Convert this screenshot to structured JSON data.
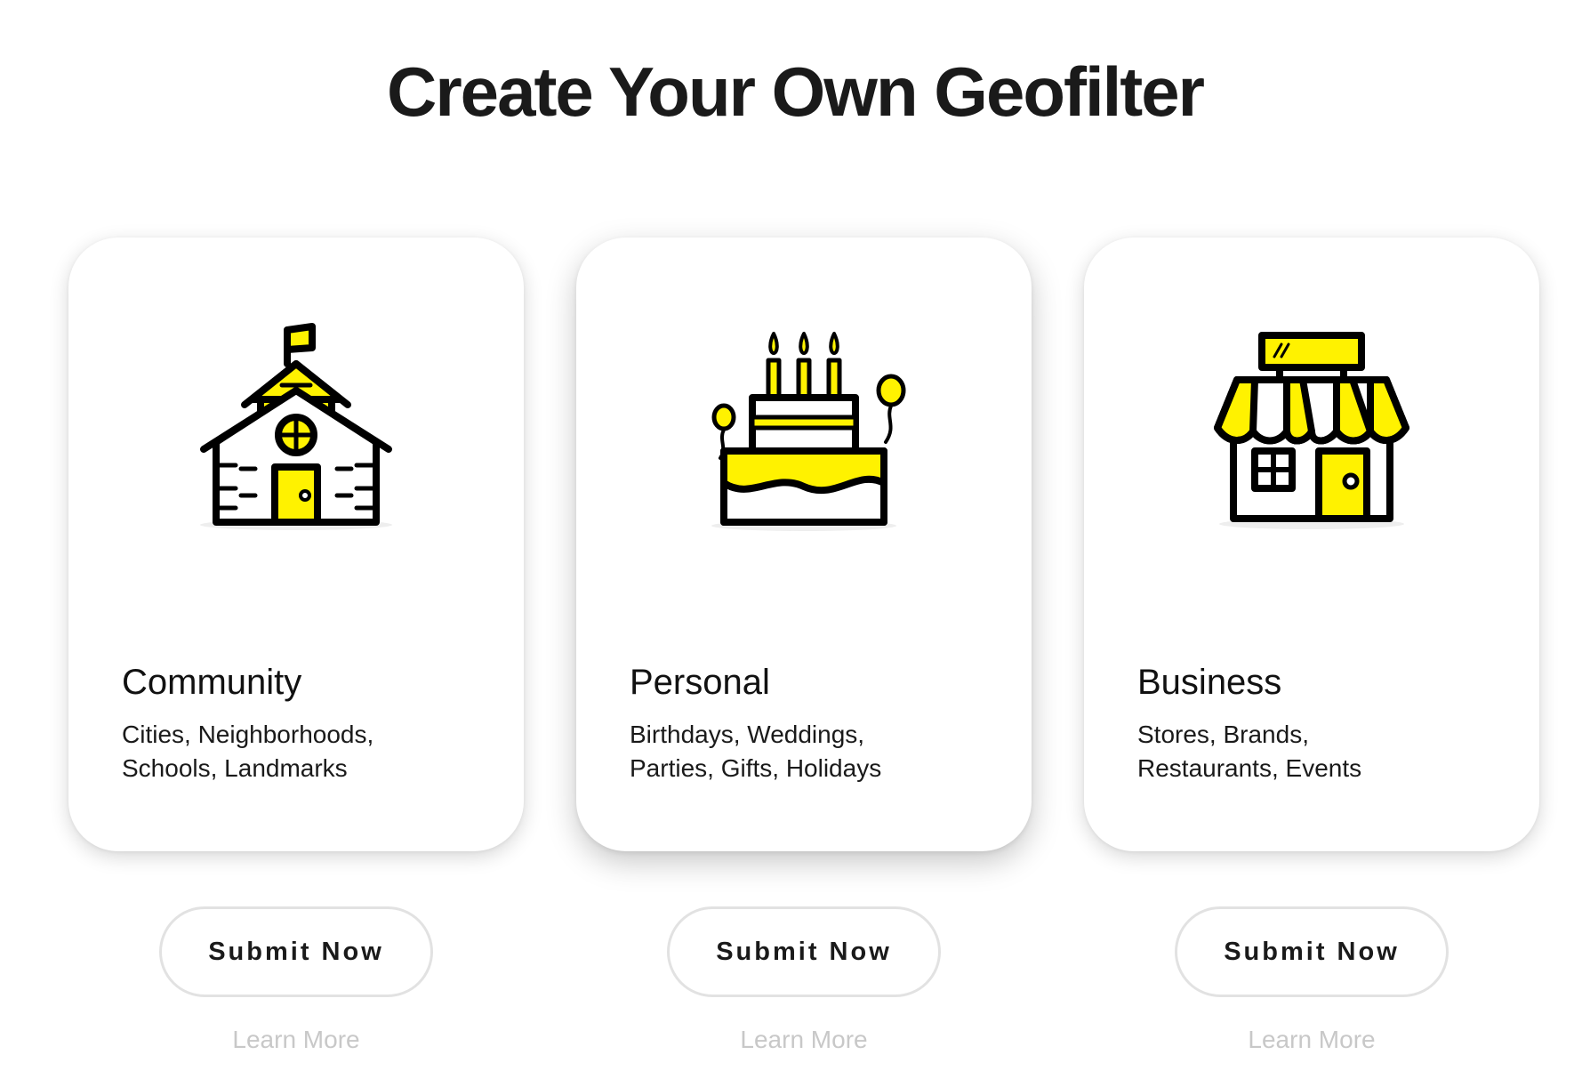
{
  "page": {
    "title": "Create Your Own Geofilter"
  },
  "colors": {
    "accent_yellow": "#FFF200",
    "outline": "#000000",
    "button_border": "#E2E2E2",
    "learn_more_text": "#C8C8C8"
  },
  "cards": [
    {
      "icon": "schoolhouse-icon",
      "title": "Community",
      "desc_line1": "Cities, Neighborhoods,",
      "desc_line2": "Schools, Landmarks",
      "submit_label": "Submit Now",
      "learn_more_label": "Learn More"
    },
    {
      "icon": "birthday-cake-icon",
      "title": "Personal",
      "desc_line1": "Birthdays, Weddings,",
      "desc_line2": "Parties, Gifts, Holidays",
      "submit_label": "Submit Now",
      "learn_more_label": "Learn More"
    },
    {
      "icon": "storefront-icon",
      "title": "Business",
      "desc_line1": "Stores, Brands,",
      "desc_line2": "Restaurants, Events",
      "submit_label": "Submit Now",
      "learn_more_label": "Learn More"
    }
  ]
}
